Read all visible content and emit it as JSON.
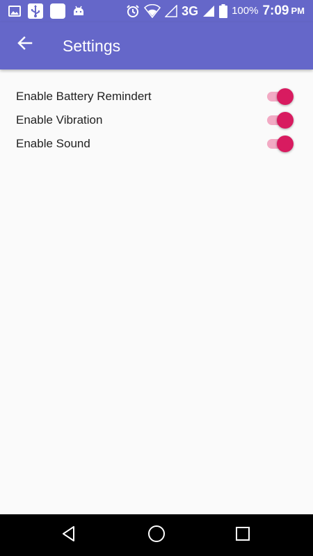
{
  "status_bar": {
    "network_type": "3G",
    "battery_percent": "100%",
    "time": "7:09",
    "ampm": "PM",
    "left_icons": [
      "image-icon",
      "usb-icon",
      "notification-square-icon",
      "android-icon"
    ],
    "right_icons": [
      "alarm-icon",
      "wifi-icon",
      "signal-empty-icon",
      "signal-icon",
      "battery-icon"
    ]
  },
  "toolbar": {
    "title": "Settings",
    "back_icon": "arrow-back-icon"
  },
  "settings": [
    {
      "label": "Enable Battery Remindert",
      "enabled": true
    },
    {
      "label": "Enable Vibration",
      "enabled": true
    },
    {
      "label": "Enable Sound",
      "enabled": true
    }
  ],
  "nav_bar": {
    "buttons": [
      "back-triangle-icon",
      "home-circle-icon",
      "recents-square-icon"
    ]
  },
  "colors": {
    "primary": "#6567c9",
    "accent": "#d81b60",
    "switch_track": "#f2aac4",
    "background": "#fafafa",
    "nav_background": "#000000"
  }
}
